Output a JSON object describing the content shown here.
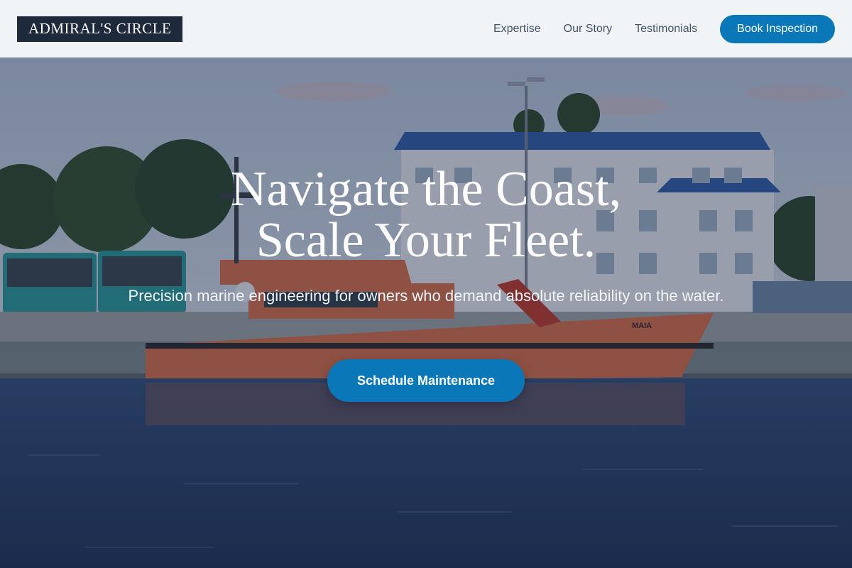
{
  "header": {
    "brand": "ADMIRAL'S CIRCLE",
    "nav": [
      {
        "label": "Expertise"
      },
      {
        "label": "Our Story"
      },
      {
        "label": "Testimonials"
      }
    ],
    "cta_label": "Book Inspection"
  },
  "hero": {
    "title_line1": "Navigate the Coast,",
    "title_line2": "Scale Your Fleet.",
    "subtitle": "Precision marine engineering for owners who demand absolute reliability on the water.",
    "cta_label": "Schedule Maintenance",
    "vessel_name": "MAIA"
  },
  "colors": {
    "brand_bg": "#1e293b",
    "accent": "#0a78b8",
    "header_bg": "#f1f4f7",
    "nav_text": "#475569",
    "hull": "#d9704a"
  }
}
